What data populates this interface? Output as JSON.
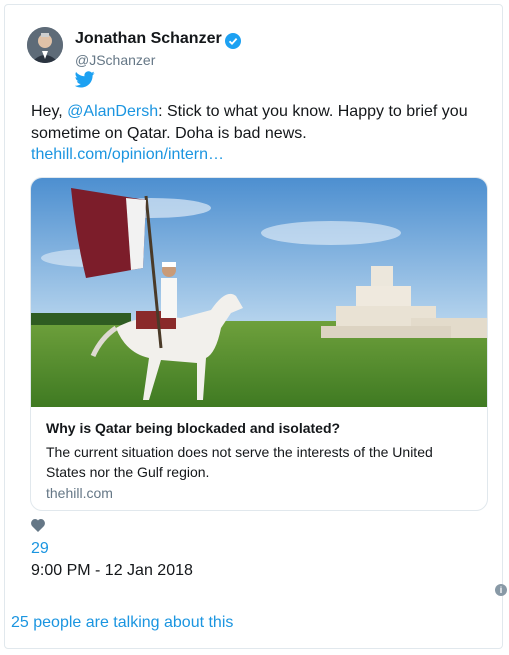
{
  "author": {
    "name": "Jonathan Schanzer",
    "handle": "@JSchanzer"
  },
  "tweet": {
    "greeting": "Hey, ",
    "mention": "@AlanDersh",
    "body": ": Stick to what you know. Happy to brief you sometime on Qatar. Doha is bad news.",
    "link": "thehill.com/opinion/intern…"
  },
  "card": {
    "title": "Why is Qatar being blockaded and isolated?",
    "description": "The current situation does not serve the interests of the United States nor the Gulf region.",
    "domain": "thehill.com"
  },
  "stats": {
    "likes": "29",
    "timestamp": "9:00 PM - 12 Jan 2018"
  },
  "footer": {
    "talking": "25 people are talking about this"
  },
  "colors": {
    "accent": "#1b95e0",
    "verified": "#1da1f2",
    "muted": "#657786"
  },
  "icons": [
    "verified-badge-icon",
    "twitter-bird-icon",
    "heart-icon",
    "info-icon"
  ]
}
